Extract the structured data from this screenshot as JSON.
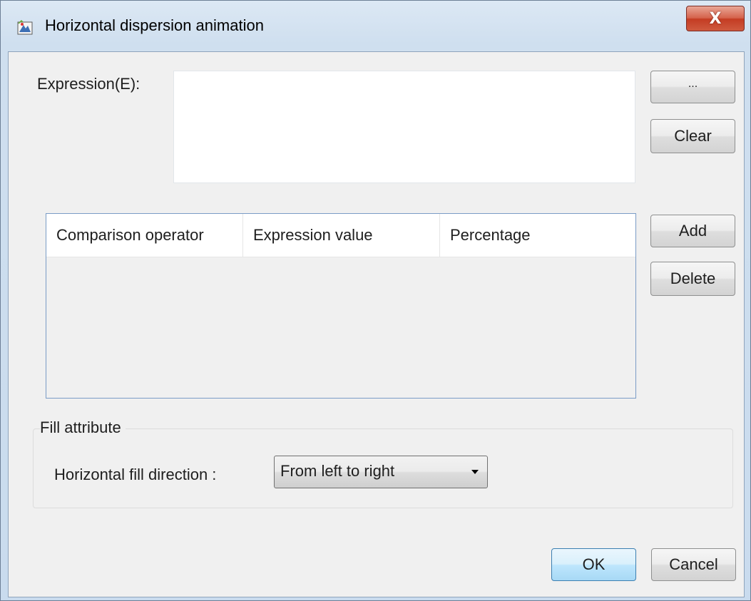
{
  "window": {
    "title": "Horizontal dispersion animation",
    "close_glyph": "X",
    "icon": "app-animation-icon"
  },
  "expression": {
    "label": "Expression(E):",
    "value": "",
    "browse_label": "...",
    "clear_label": "Clear"
  },
  "table": {
    "columns": [
      "Comparison operator",
      "Expression value",
      "Percentage"
    ],
    "rows": [],
    "add_label": "Add",
    "delete_label": "Delete"
  },
  "fill": {
    "group_title": "Fill attribute",
    "direction_label": "Horizontal fill direction :",
    "direction_value": "From left to right"
  },
  "footer": {
    "ok_label": "OK",
    "cancel_label": "Cancel"
  },
  "colors": {
    "close_button": "#c94a31",
    "ok_button_border": "#3c7fb1",
    "table_border": "#7a9cc6"
  }
}
